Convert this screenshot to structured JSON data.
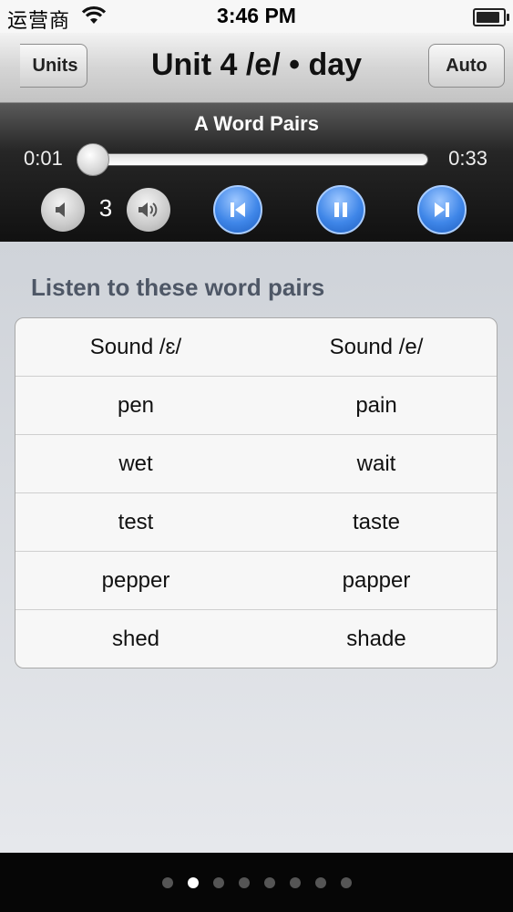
{
  "status_bar": {
    "carrier": "运营商",
    "time": "3:46 PM",
    "battery_level": 0.9
  },
  "nav": {
    "back_label": "Units",
    "title": "Unit 4 /e/ • day",
    "auto_label": "Auto"
  },
  "player": {
    "track_title": "A Word Pairs",
    "time_elapsed": "0:01",
    "time_total": "0:33",
    "progress": 0.03,
    "volume": "3",
    "accent_color": "#3f86e8"
  },
  "content": {
    "heading": "Listen to these word pairs",
    "table": {
      "headers": [
        "Sound /ɛ/",
        "Sound /e/"
      ],
      "rows": [
        [
          "pen",
          "pain"
        ],
        [
          "wet",
          "wait"
        ],
        [
          "test",
          "taste"
        ],
        [
          "pepper",
          "papper"
        ],
        [
          "shed",
          "shade"
        ]
      ]
    }
  },
  "pager": {
    "count": 8,
    "active_index": 1
  },
  "icons": {
    "wifi": "wifi-icon",
    "battery": "battery-icon",
    "volume_down": "speaker-low-icon",
    "volume_up": "speaker-high-icon",
    "previous": "skip-previous-icon",
    "pause": "pause-icon",
    "next": "skip-next-icon"
  }
}
